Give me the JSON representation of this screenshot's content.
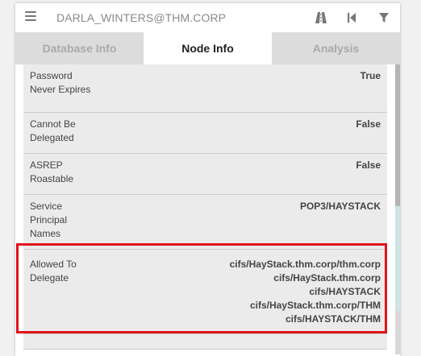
{
  "header": {
    "title": "DARLA_WINTERS@THM.CORP",
    "icons": [
      "menu-icon",
      "road-icon",
      "skip-back-icon",
      "filter-icon"
    ]
  },
  "tabs": [
    {
      "label": "Database Info",
      "active": false
    },
    {
      "label": "Node Info",
      "active": true
    },
    {
      "label": "Analysis",
      "active": false
    }
  ],
  "properties": [
    {
      "label": "Password Never Expires",
      "values": [
        "True"
      ]
    },
    {
      "label": "Cannot Be Delegated",
      "values": [
        "False"
      ]
    },
    {
      "label": "ASREP Roastable",
      "values": [
        "False"
      ]
    },
    {
      "label": "Service Principal Names",
      "values": [
        "POP3/HAYSTACK"
      ]
    },
    {
      "label": "Allowed To Delegate",
      "values": [
        "cifs/HayStack.thm.corp/thm.corp",
        "cifs/HayStack.thm.corp",
        "cifs/HAYSTACK",
        "cifs/HayStack.thm.corp/THM",
        "cifs/HAYSTACK/THM"
      ]
    }
  ],
  "colors": {
    "highlight": "#e0141b",
    "inactive_tab": "#dcdcdc",
    "content_bg": "#ebebeb"
  }
}
